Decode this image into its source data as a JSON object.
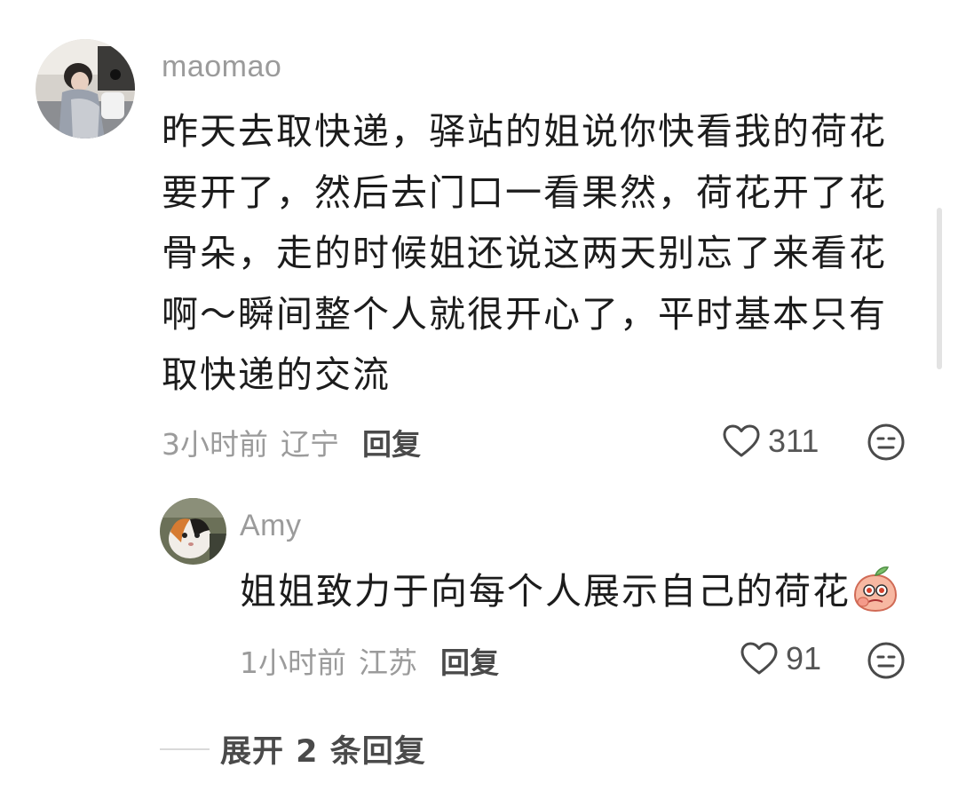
{
  "main_comment": {
    "username": "maomao",
    "text": "昨天去取快递，驿站的姐说你快看我的荷花\n要开了，然后去门口一看果然，荷花开了花\n骨朵，走的时候姐还说这两天别忘了来看花\n啊～瞬间整个人就很开心了，平时基本只有\n取快递的交流",
    "time": "3小时前",
    "region": "辽宁",
    "reply_label": "回复",
    "likes": "311",
    "icons": {
      "like": "heart-outline-icon",
      "dislike": "unamused-face-icon"
    }
  },
  "reply": {
    "username": "Amy",
    "text": "姐姐致力于向每个人展示自己的荷花",
    "sticker": "peach-emoji-sticker",
    "time": "1小时前",
    "region": "江苏",
    "reply_label": "回复",
    "likes": "91"
  },
  "expand": {
    "label": "展开 2 条回复"
  },
  "colors": {
    "text_primary": "#1c1c1c",
    "text_secondary": "#9b9b9b",
    "reply_link": "#4a4a4a",
    "background": "#ffffff"
  }
}
